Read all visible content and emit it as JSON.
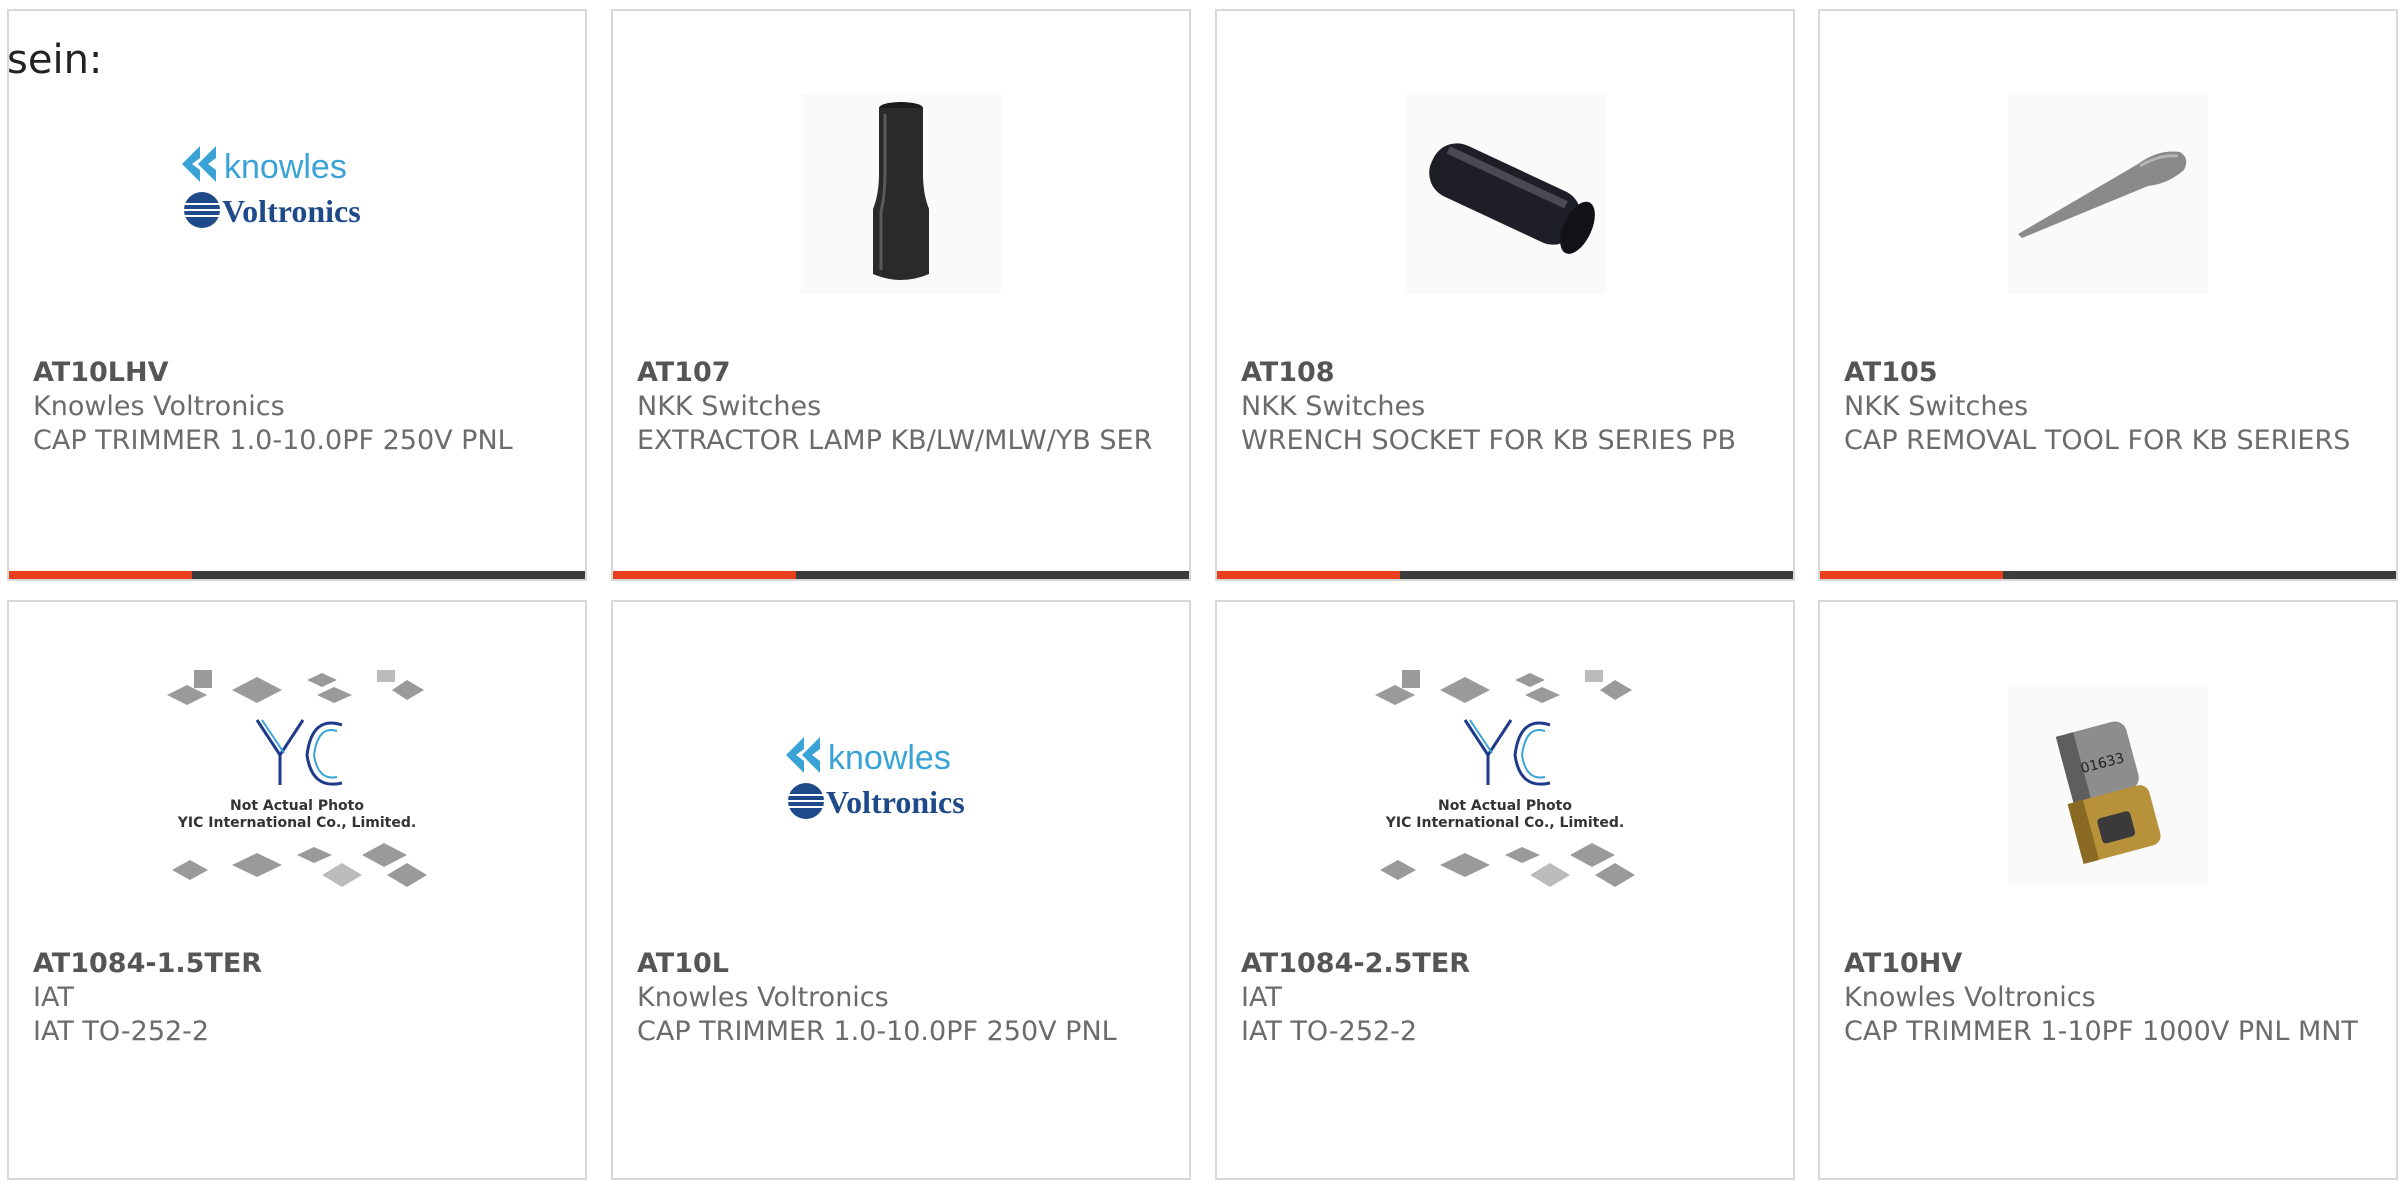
{
  "prefix_text": "sein:",
  "colors": {
    "accent": "#e8401c",
    "bar": "#3b3b3b",
    "border": "#d8d8d8",
    "text": "#6b6b6b",
    "knowles_blue": "#3aa3d6",
    "voltronics_navy": "#1f4a8a"
  },
  "products": [
    {
      "part_number": "AT10LHV",
      "manufacturer": "Knowles Voltronics",
      "description": "CAP TRIMMER 1.0-10.0PF 250V PNL",
      "image": "knowles-voltronics-logo"
    },
    {
      "part_number": "AT107",
      "manufacturer": "NKK Switches",
      "description": "EXTRACTOR LAMP KB/LW/MLW/YB SER",
      "image": "black-lamp-extractor-photo"
    },
    {
      "part_number": "AT108",
      "manufacturer": "NKK Switches",
      "description": "WRENCH SOCKET FOR KB SERIES PB",
      "image": "black-wrench-socket-photo"
    },
    {
      "part_number": "AT105",
      "manufacturer": "NKK Switches",
      "description": "CAP REMOVAL TOOL FOR KB SERIERS",
      "image": "cap-removal-tool-photo"
    },
    {
      "part_number": "AT1084-1.5TER",
      "manufacturer": "IAT",
      "description": "IAT TO-252-2",
      "image": "yic-not-actual-photo",
      "image_caption": [
        "Not Actual Photo",
        "YIC International Co., Limited."
      ]
    },
    {
      "part_number": "AT10L",
      "manufacturer": "Knowles Voltronics",
      "description": "CAP TRIMMER 1.0-10.0PF 250V PNL",
      "image": "knowles-voltronics-logo"
    },
    {
      "part_number": "AT1084-2.5TER",
      "manufacturer": "IAT",
      "description": "IAT TO-252-2",
      "image": "yic-not-actual-photo",
      "image_caption": [
        "Not Actual Photo",
        "YIC International Co., Limited."
      ]
    },
    {
      "part_number": "AT10HV",
      "manufacturer": "Knowles Voltronics",
      "description": "CAP TRIMMER 1-10PF 1000V PNL MNT",
      "image": "trimmer-capacitor-photo"
    }
  ],
  "logo": {
    "knowles": "knowles",
    "voltronics": "Voltronics"
  }
}
